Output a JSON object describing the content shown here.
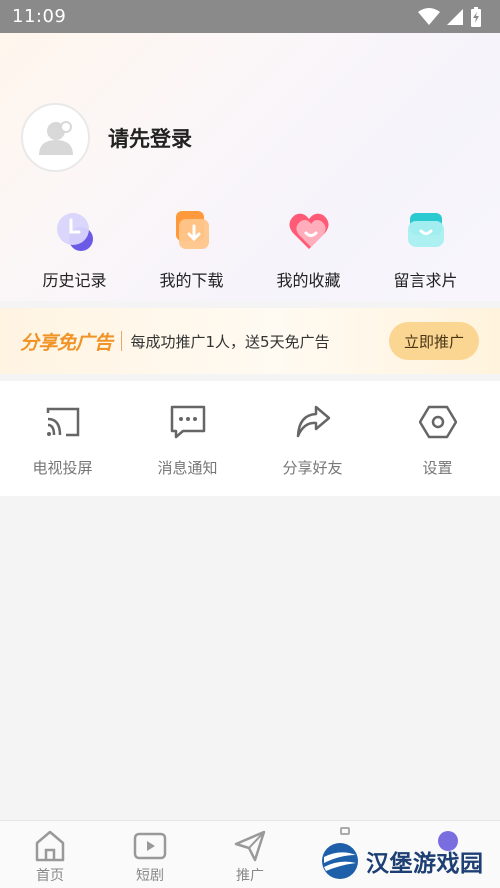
{
  "status_bar": {
    "time": "11:09",
    "icons": [
      "wifi-icon",
      "signal-icon",
      "battery-icon"
    ]
  },
  "profile": {
    "login_prompt": "请先登录",
    "avatar_icon": "user-avatar-icon"
  },
  "quick_actions": [
    {
      "label": "历史记录",
      "icon": "history-icon",
      "color": "#7b6cf0"
    },
    {
      "label": "我的下载",
      "icon": "download-icon",
      "color": "#ff9a3c"
    },
    {
      "label": "我的收藏",
      "icon": "favorite-icon",
      "color": "#ff5a76"
    },
    {
      "label": "留言求片",
      "icon": "message-request-icon",
      "color": "#2bc9d0"
    }
  ],
  "promo": {
    "title": "分享免广告",
    "text": "每成功推广1人，送5天免广告",
    "button": "立即推广"
  },
  "tools": [
    {
      "label": "电视投屏",
      "icon": "cast-icon"
    },
    {
      "label": "消息通知",
      "icon": "message-icon"
    },
    {
      "label": "分享好友",
      "icon": "share-icon"
    },
    {
      "label": "设置",
      "icon": "settings-icon"
    }
  ],
  "bottom_nav": [
    {
      "label": "首页",
      "icon": "home-icon"
    },
    {
      "label": "短剧",
      "icon": "video-icon"
    },
    {
      "label": "推广",
      "icon": "send-icon"
    }
  ],
  "watermark": {
    "text": "汉堡游戏园"
  },
  "colors": {
    "accent": "#f09428",
    "promo_button": "#fad692",
    "icon_gray": "#666666"
  }
}
